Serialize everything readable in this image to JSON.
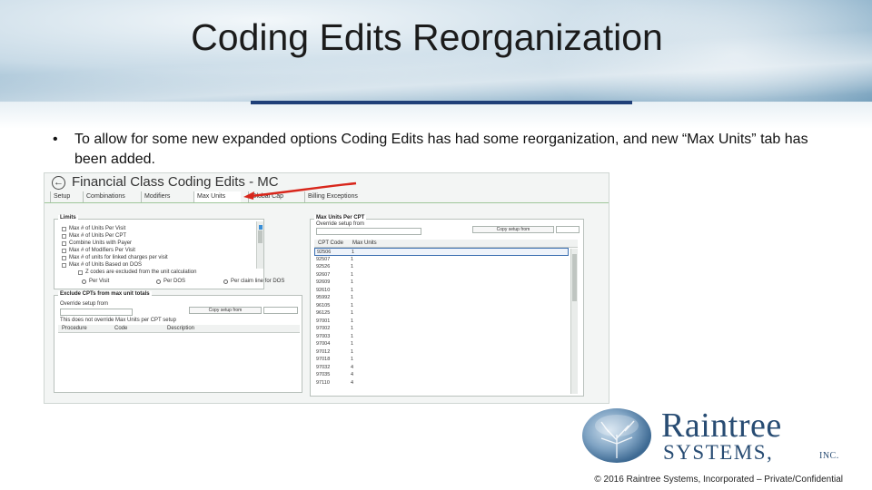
{
  "slide": {
    "title": "Coding Edits Reorganization",
    "bullet": "•",
    "bullet_text": "To allow for some new expanded options Coding Edits has had some reorganization, and new “Max Units” tab has been added."
  },
  "screenshot": {
    "window_title": "Financial Class Coding Edits - MC",
    "back_glyph": "←",
    "tabs": [
      {
        "label": "Setup",
        "active": false
      },
      {
        "label": "Combinations",
        "active": false
      },
      {
        "label": "Modifiers",
        "active": false
      },
      {
        "label": "Max Units",
        "active": true
      },
      {
        "label": "Global Cap",
        "active": false
      },
      {
        "label": "Billing Exceptions",
        "active": false
      }
    ],
    "limits_panel": {
      "legend": "Limits",
      "options": [
        "Max # of Units Per Visit",
        "Max # of Units Per CPT",
        "Combine Units with Payer",
        "Max # of Modifiers Per Visit",
        "Max # of units for linked charges per visit",
        "Max # of Units Based on DOS",
        "Z codes are excluded from the unit calculation"
      ],
      "radios": [
        "Per Visit",
        "Per DOS",
        "Per claim line for DOS"
      ]
    },
    "exclude_panel": {
      "legend": "Exclude CPTs from max unit totals",
      "override_label": "Override setup from",
      "copy_button": "Copy setup from",
      "note": "This does not override Max Units per CPT setup",
      "columns": [
        "Procedure",
        "Code",
        "Description"
      ]
    },
    "max_units_panel": {
      "legend": "Max Units Per CPT",
      "override_label": "Override setup from",
      "copy_button": "Copy setup from",
      "columns": [
        "CPT Code",
        "Max Units"
      ],
      "rows": [
        {
          "code": "92506",
          "units": "1"
        },
        {
          "code": "92507",
          "units": "1"
        },
        {
          "code": "92526",
          "units": "1"
        },
        {
          "code": "92607",
          "units": "1"
        },
        {
          "code": "92609",
          "units": "1"
        },
        {
          "code": "92610",
          "units": "1"
        },
        {
          "code": "95992",
          "units": "1"
        },
        {
          "code": "96105",
          "units": "1"
        },
        {
          "code": "96125",
          "units": "1"
        },
        {
          "code": "97001",
          "units": "1"
        },
        {
          "code": "97002",
          "units": "1"
        },
        {
          "code": "97003",
          "units": "1"
        },
        {
          "code": "97004",
          "units": "1"
        },
        {
          "code": "97012",
          "units": "1"
        },
        {
          "code": "97018",
          "units": "1"
        },
        {
          "code": "97032",
          "units": "4"
        },
        {
          "code": "97035",
          "units": "4"
        },
        {
          "code": "97110",
          "units": "4"
        }
      ]
    }
  },
  "logo": {
    "line1": "Raintree",
    "line2": "SYSTEMS,",
    "line3": "INC."
  },
  "footer": "© 2016 Raintree Systems, Incorporated – Private/Confidential"
}
